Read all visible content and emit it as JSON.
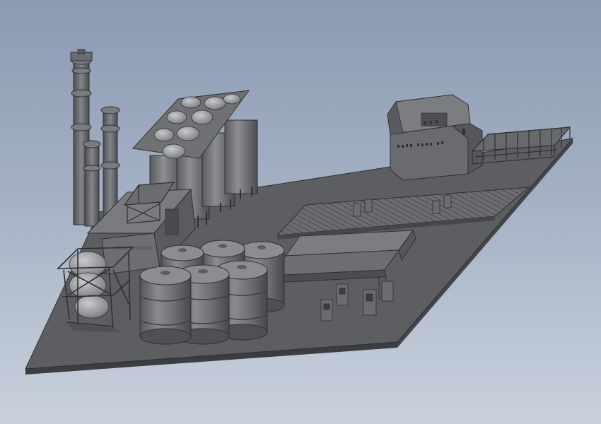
{
  "viewport": {
    "background_top": "#8c9bb2",
    "background_bottom": "#c9d1dd"
  },
  "model": {
    "base_color": "#5d5e62",
    "part_color": "#6b6c70",
    "edge_color": "#2f3033",
    "highlight_color": "#a4a5a9",
    "sign_text": "▯▯▯▯▯▯▯▯▯▯ ▯▯▯▯▯"
  }
}
